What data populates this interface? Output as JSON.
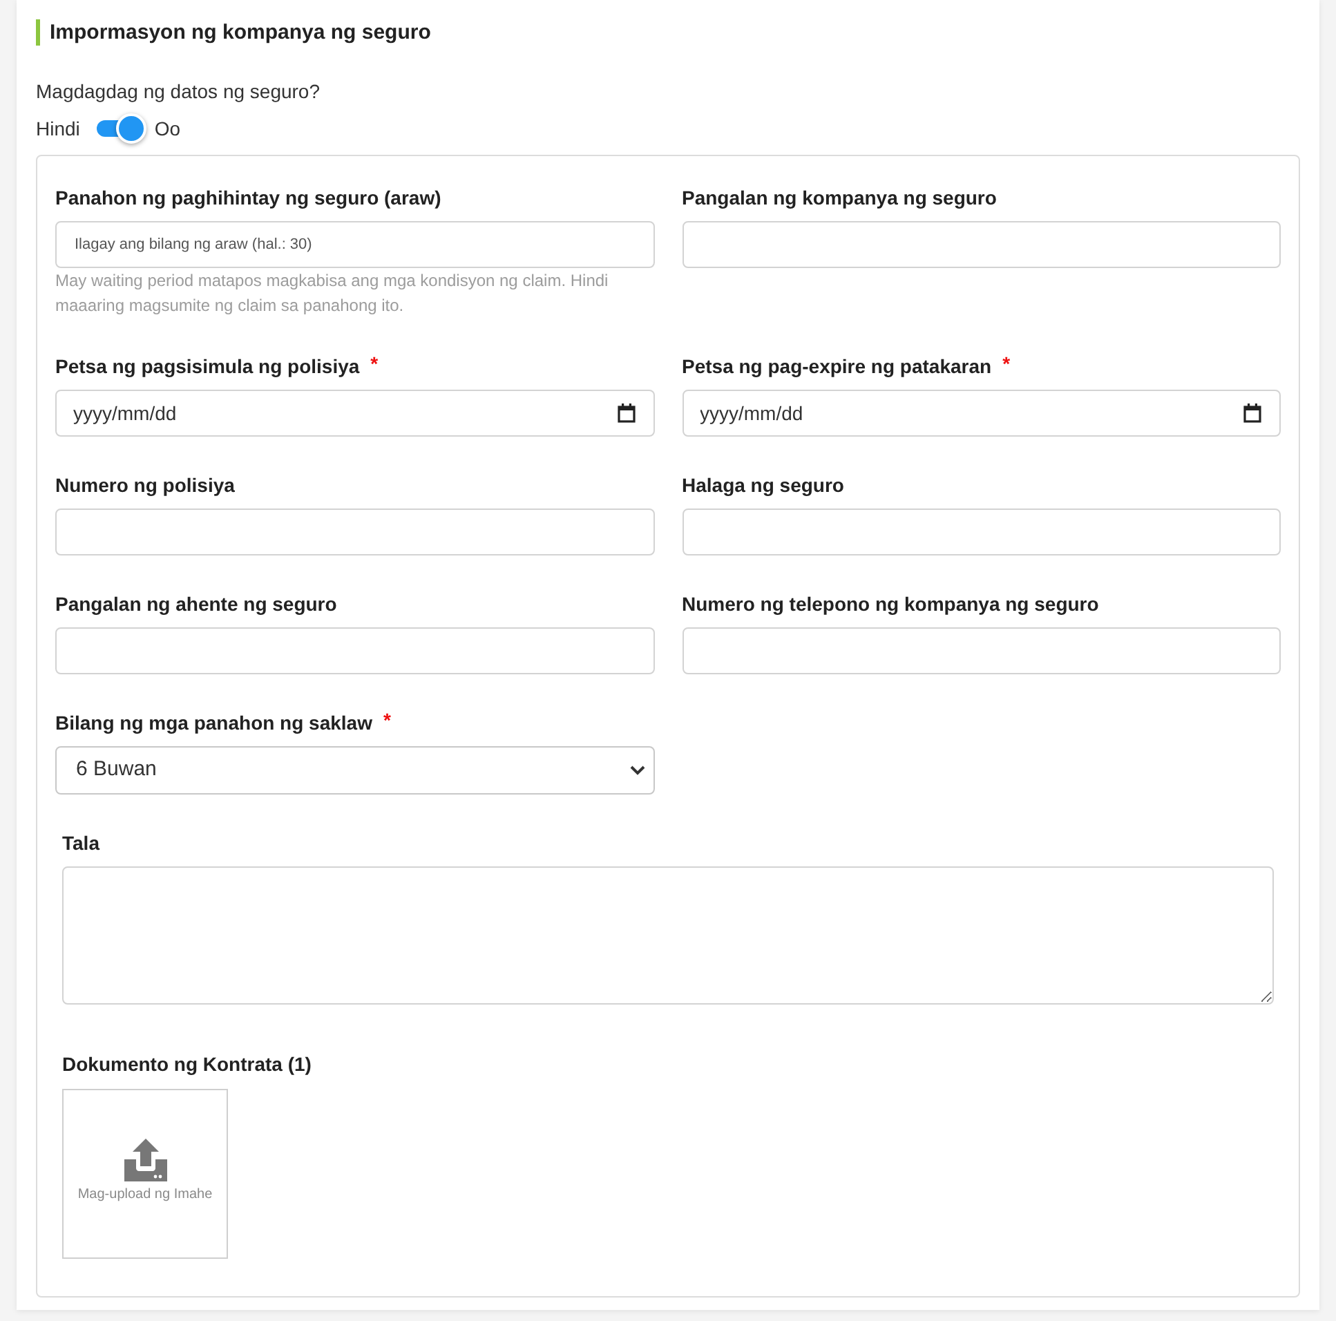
{
  "section": {
    "title": "Impormasyon ng kompanya ng seguro"
  },
  "insurance_toggle": {
    "question": "Magdagdag ng datos ng seguro?",
    "off_label": "Hindi",
    "on_label": "Oo",
    "on": true
  },
  "fields": [
    {
      "kind": "text",
      "label": "Panahon ng paghihintay ng seguro (araw)",
      "placeholder": "Ilagay ang bilang ng araw (hal.: 30)",
      "help": "May waiting period matapos magkabisa ang mga kondisyon ng claim. Hindi maaaring magsumite ng claim sa panahong ito."
    },
    {
      "kind": "text",
      "label": "Pangalan ng kompanya ng seguro"
    },
    {
      "kind": "date",
      "label": "Petsa ng pagsisimula ng polisiya",
      "required_mark": "*",
      "placeholder": "yyyy/mm/dd"
    },
    {
      "kind": "date",
      "label": "Petsa ng pag-expire ng patakaran",
      "required_mark": "*",
      "placeholder": "yyyy/mm/dd"
    },
    {
      "kind": "text",
      "label": "Numero ng polisiya"
    },
    {
      "kind": "text",
      "label": "Halaga ng seguro"
    },
    {
      "kind": "text",
      "label": "Pangalan ng ahente ng seguro"
    },
    {
      "kind": "text",
      "label": "Numero ng telepono ng kompanya ng seguro"
    },
    {
      "kind": "select",
      "label": "Bilang ng mga panahon ng saklaw",
      "required_mark": "*",
      "value": "6 Buwan"
    }
  ],
  "notes": {
    "label": "Tala"
  },
  "contract_upload": {
    "label": "Dokumento ng Kontrata (1)",
    "button_text": "Mag-upload ng Imahe"
  }
}
